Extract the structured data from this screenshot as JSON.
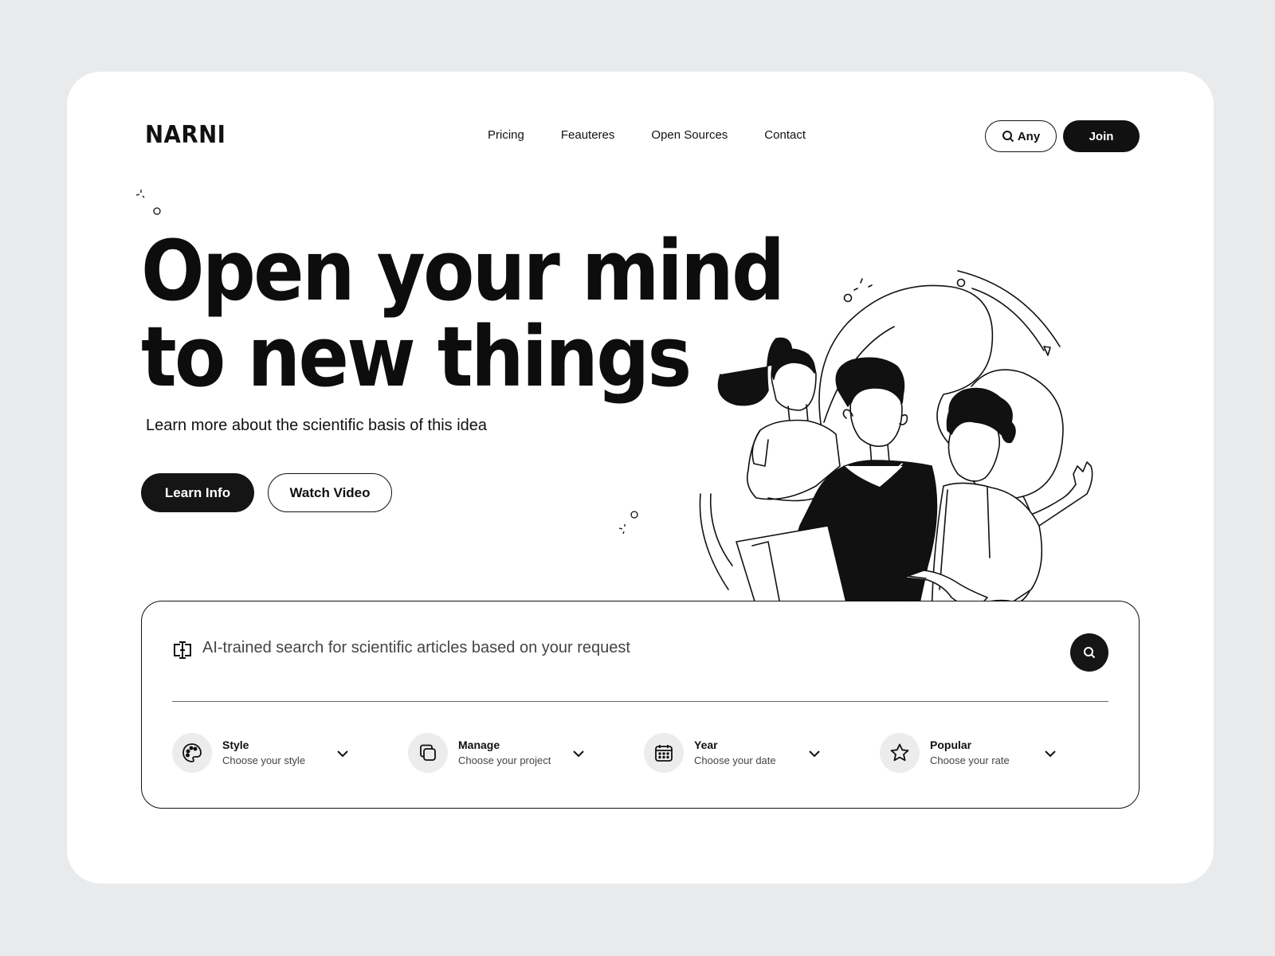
{
  "brand": {
    "logo": "NARNI"
  },
  "nav": {
    "items": [
      "Pricing",
      "Feauteres",
      "Open Sources",
      "Contact"
    ]
  },
  "header_actions": {
    "any_label": "Any",
    "join_label": "Join"
  },
  "hero": {
    "headline_line1": "Open your mind",
    "headline_line2": "to new things",
    "subtitle": "Learn more about the scientific basis of this idea",
    "primary_cta": "Learn Info",
    "secondary_cta": "Watch Video"
  },
  "search": {
    "placeholder": "AI-trained search for scientific articles based on your request",
    "filters": [
      {
        "title": "Style",
        "subtitle": "Choose your style",
        "icon": "palette-icon"
      },
      {
        "title": "Manage",
        "subtitle": "Choose your project",
        "icon": "copy-icon"
      },
      {
        "title": "Year",
        "subtitle": "Choose your date",
        "icon": "calendar-icon"
      },
      {
        "title": "Popular",
        "subtitle": "Choose your rate",
        "icon": "star-icon"
      }
    ]
  },
  "colors": {
    "background": "#e8eaeb",
    "card": "#ffffff",
    "ink": "#111111",
    "chip": "#ececec"
  }
}
